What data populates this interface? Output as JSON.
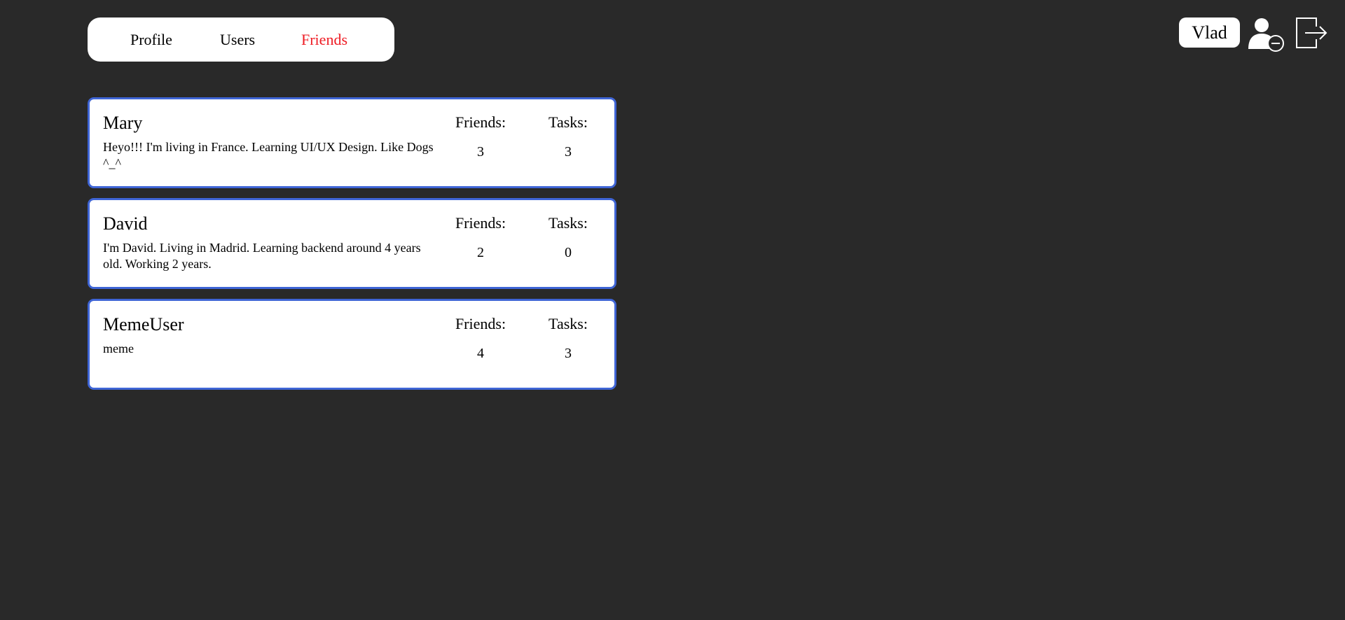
{
  "nav": {
    "items": [
      {
        "label": "Profile",
        "active": false
      },
      {
        "label": "Users",
        "active": false
      },
      {
        "label": "Friends",
        "active": true
      }
    ],
    "active_color": "#ee1c24"
  },
  "header": {
    "username": "Vlad",
    "icons": [
      "remove-user-icon",
      "logout-icon"
    ]
  },
  "friends": [
    {
      "name": "Mary",
      "bio": "Heyo!!! I'm living in France. Learning UI/UX Design. Like Dogs ^_^",
      "friends_label": "Friends:",
      "friends_count": "3",
      "tasks_label": "Tasks:",
      "tasks_count": "3"
    },
    {
      "name": "David",
      "bio": "I'm David. Living in Madrid. Learning backend around 4 years old. Working 2 years.",
      "friends_label": "Friends:",
      "friends_count": "2",
      "tasks_label": "Tasks:",
      "tasks_count": "0"
    },
    {
      "name": "MemeUser",
      "bio": "meme",
      "friends_label": "Friends:",
      "friends_count": "4",
      "tasks_label": "Tasks:",
      "tasks_count": "3"
    }
  ],
  "colors": {
    "background": "#292929",
    "card_border": "#3f65d6"
  }
}
